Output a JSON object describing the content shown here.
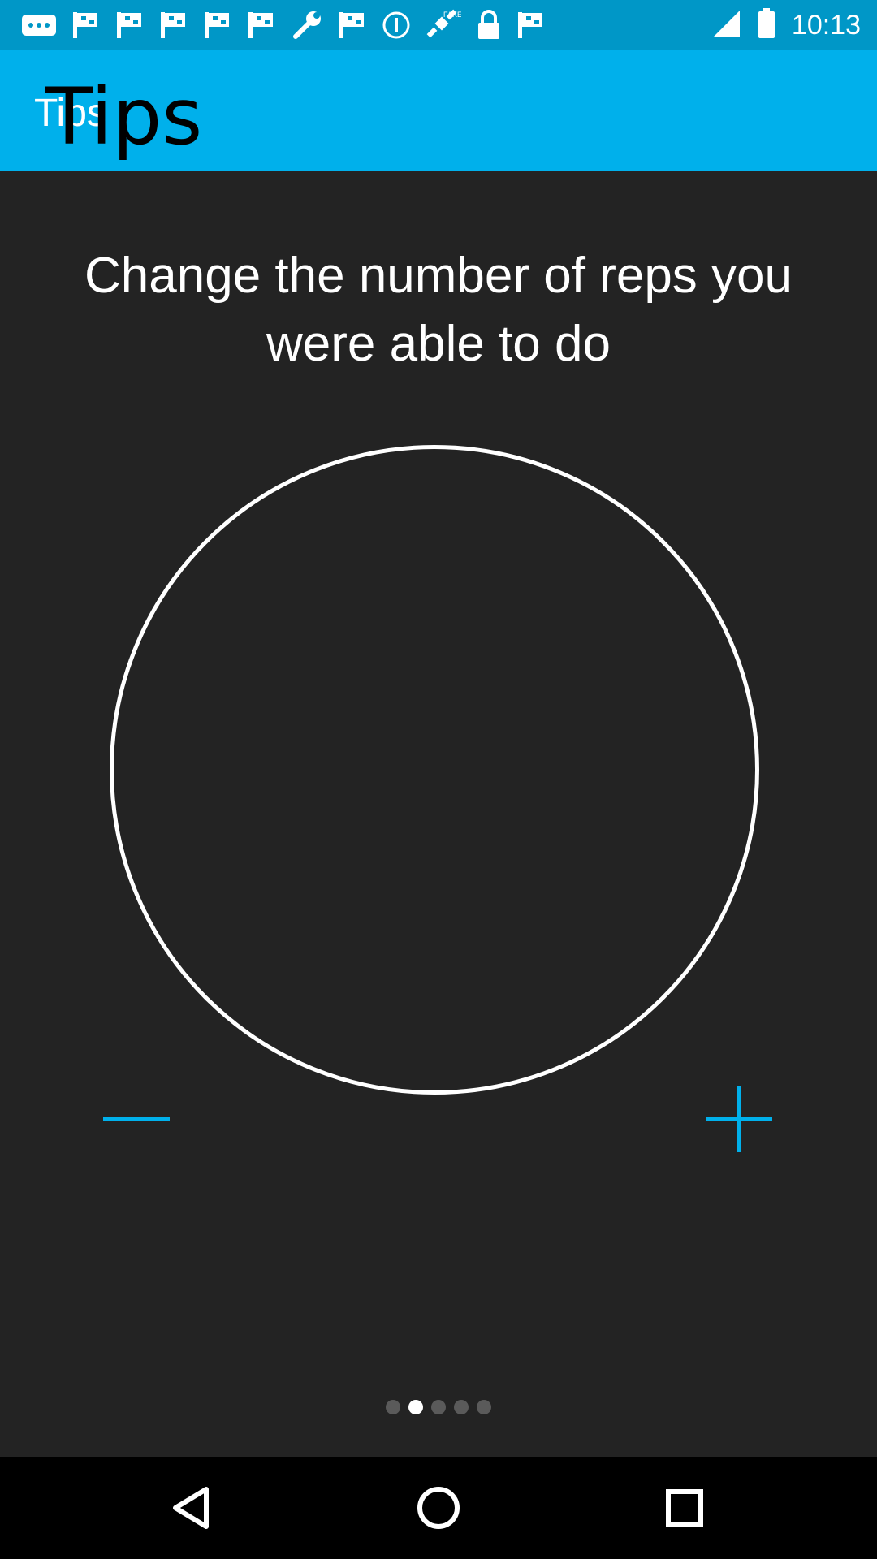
{
  "status_bar": {
    "time": "10:13",
    "icons": [
      "message-icon",
      "flag-icon",
      "flag-icon",
      "flag-icon",
      "flag-icon",
      "flag-icon",
      "wrench-icon",
      "flag-icon",
      "info-icon",
      "satellite-icon",
      "lock-icon",
      "flag-icon"
    ],
    "fake_gps_label": "FAKE"
  },
  "app_bar": {
    "title": "Tips",
    "title_overlay": "Tips"
  },
  "main": {
    "tip_text": "Change the number of reps you were able to do",
    "page_indicator": {
      "count": 5,
      "active_index": 1
    }
  },
  "colors": {
    "status_bar": "#0097c7",
    "app_bar": "#00b0eb",
    "accent": "#00b0eb",
    "background": "#232323"
  }
}
